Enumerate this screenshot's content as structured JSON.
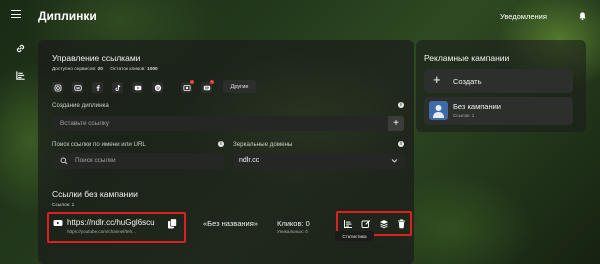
{
  "header": {
    "title": "Диплинки",
    "notifications_label": "Уведомления"
  },
  "links_management": {
    "title": "Управление ссылками",
    "services_label": "Доступно сервисов:",
    "services_count": "20",
    "clicks_label": "Остаток кликов:",
    "clicks_count": "1000",
    "social_icons": [
      "instagram-icon",
      "vk-icon",
      "facebook-icon",
      "tiktok-icon",
      "youtube-icon",
      "spotify-icon",
      "custom-icon",
      "pinterest-icon"
    ],
    "others_button": "Другие"
  },
  "create": {
    "label": "Создание диплинка",
    "placeholder": "Вставьте ссылку"
  },
  "search": {
    "label": "Поиск ссылки по имени или URL",
    "placeholder": "Поиск ссылки"
  },
  "domains": {
    "label": "Зеркальные домены",
    "selected": "ndlr.cc"
  },
  "no_campaign_links": {
    "title": "Ссылки без кампании",
    "count_label": "Ссылок: 1",
    "link": {
      "short_url": "https://ndlr.cc/huGgl6scu",
      "original_url": "https://youtube.com/channel/teh...",
      "name": "«Без названия»",
      "clicks": "Кликов: 0",
      "unique": "Уникальных: 0"
    },
    "tooltip": "Статистика"
  },
  "campaigns": {
    "title": "Рекламные кампании",
    "create_label": "Создать",
    "items": [
      {
        "name": "Без кампании",
        "sub": "Ссылок: 1"
      }
    ]
  },
  "colors": {
    "accent_red": "#e02020"
  }
}
